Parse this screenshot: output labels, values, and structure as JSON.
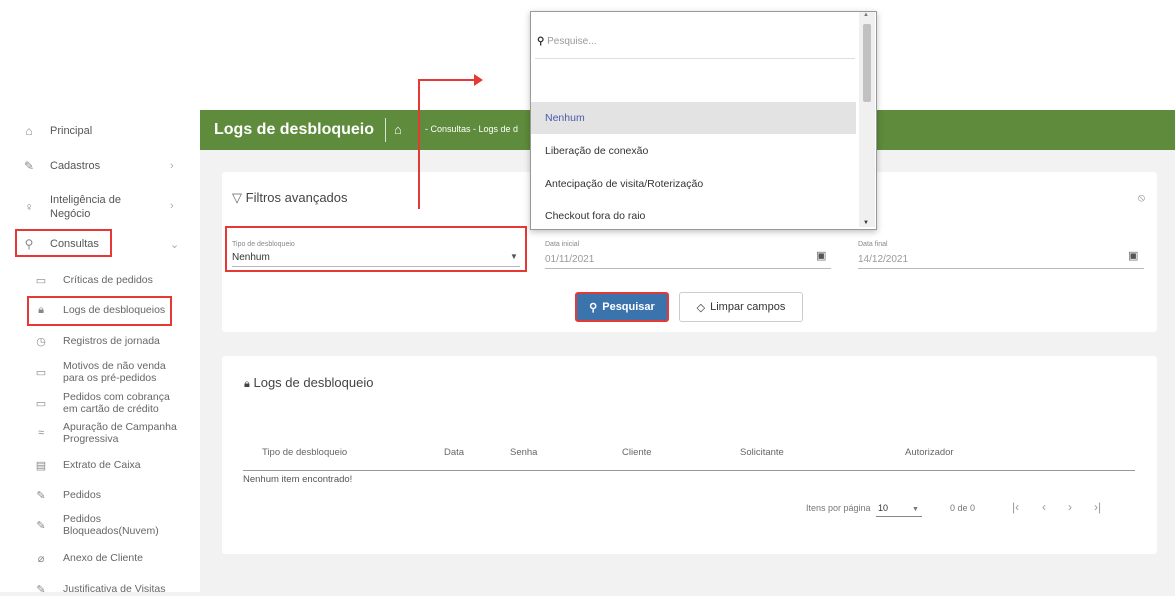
{
  "colors": {
    "header_bg": "#5e8b3c",
    "accent": "#3b73ad",
    "highlight": "#e53935"
  },
  "sidebar": {
    "items": [
      {
        "label": "Principal",
        "icon": "home-icon"
      },
      {
        "label": "Cadastros",
        "icon": "edit-icon"
      },
      {
        "label": "Inteligência de Negócio",
        "icon": "bulb-icon"
      },
      {
        "label": "Consultas",
        "icon": "search-icon"
      }
    ],
    "subitems": [
      {
        "label": "Críticas de pedidos",
        "icon": "chat-icon"
      },
      {
        "label": "Logs de desbloqueios",
        "icon": "lock-icon"
      },
      {
        "label": "Registros de jornada",
        "icon": "clock-icon"
      },
      {
        "label": "Motivos de não venda para os pré-pedidos",
        "icon": "chat-icon"
      },
      {
        "label": "Pedidos com cobrança em cartão de crédito",
        "icon": "card-icon"
      },
      {
        "label": "Apuração de Campanha Progressiva",
        "icon": "chart-icon"
      },
      {
        "label": "Extrato de Caixa",
        "icon": "document-icon"
      },
      {
        "label": "Pedidos",
        "icon": "edit-icon"
      },
      {
        "label": "Pedidos Bloqueados(Nuvem)",
        "icon": "edit-icon"
      },
      {
        "label": "Anexo de Cliente",
        "icon": "paperclip-icon"
      },
      {
        "label": "Justificativa de Visitas",
        "icon": "edit-icon"
      }
    ]
  },
  "header": {
    "title": "Logs de desbloqueio",
    "breadcrumb": "- Consultas - Logs de d"
  },
  "filters": {
    "title": "Filtros avançados",
    "tipo_label": "Tipo de desbloqueio",
    "tipo_value": "Nenhum",
    "data_inicial_label": "Data inicial",
    "data_inicial_value": "01/11/2021",
    "data_final_label": "Data final",
    "data_final_value": "14/12/2021",
    "search_button": "Pesquisar",
    "clear_button": "Limpar campos"
  },
  "dropdown": {
    "search_placeholder": "Pesquise...",
    "options": [
      "Nenhum",
      "Liberação de conexão",
      "Antecipação de visita/Roterização",
      "Checkout fora do raio"
    ],
    "selected": "Nenhum"
  },
  "results": {
    "title": "Logs de desbloqueio",
    "columns": [
      "Tipo de desbloqueio",
      "Data",
      "Senha",
      "Cliente",
      "Solicitante",
      "Autorizador"
    ],
    "empty_text": "Nenhum item encontrado!",
    "items_per_page_label": "Itens por página",
    "items_per_page": "10",
    "range": "0 de 0"
  }
}
